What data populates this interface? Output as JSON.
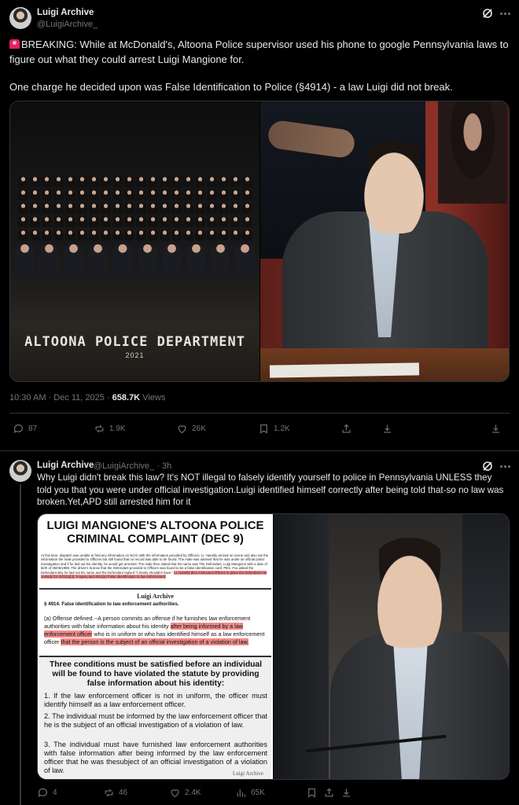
{
  "tweet1": {
    "author_name": "Luigi Archive",
    "author_handle": "@LuigiArchive_",
    "text_line1": "BREAKING: While at McDonald's, Altoona Police supervisor used his phone to google Pennsylvania laws to figure out what they could arrest Luigi Mangione for.",
    "text_line2": "One charge he decided upon was False Identification to Police (§4914) - a law Luigi did not break.",
    "image_left_title": "ALTOONA POLICE DEPARTMENT",
    "image_left_year": "2021",
    "time": "10:30 AM · Dec 11, 2025 · ",
    "views_count": "658.7K",
    "views_label": "Views",
    "replies": "87",
    "reposts": "1.9K",
    "likes": "26K",
    "bookmarks": "1.2K"
  },
  "tweet2": {
    "author_name": "Luigi Archive",
    "author_handle": "@LuigiArchive_ · 3h",
    "text": "Why Luigi didn't break this law? It's NOT illegal to falsely identify yourself to police in Pennsylvania UNLESS they told you that you were under official investigation.Luigi identified himself correctly after being told that-so no law was broken.Yet,APD still arrested him for it",
    "doc_title_line1": "LUIGI MANGIONE'S ALTOONA POLICE",
    "doc_title_line2": "CRIMINAL COMPLAINT (DEC 9)",
    "doc_complaint_text": "At this time, dispatch was unable to find any information on NCIC with the information provided by Officers. Lt. Hanelly arrived on scene and also ran the information the male provided to Officers but still found that no record was able to be found. The male was advised that he was under an official police investigation and if he lied out his identity, he would get arrested. The male then stated that his name was The Defendant, Luigi Mangione with a date of birth of 05/06/1998. The driver's license that the Defendant provided to Officers was found to be a false identification card. Ptlm. Fox asked the Defendant why he lied out his name and the Defendant replied \"I clearly shouldn't have.\"",
    "doc_complaint_highlight": "Lt. Hanelly then instructed Officers to place the Defendant into custody for 4101(a)(3), Forgery and 4914(a) False identification to law enforcement.",
    "doc_watermark": "Luigi Archive",
    "doc_section_head": "§ 4914. False identification to law enforcement authorities.",
    "doc_offense_a": "(a) Offense defined.--A person commits an offense if he furnishes law enforcement authorities with false information about his identity ",
    "doc_offense_hl1": "after being informed by a law enforcement officer",
    "doc_offense_b": " who is in uniform or who has identified himself as a law enforcement officer ",
    "doc_offense_hl2": "that the person is the subject of an official investigation of a violation of law.",
    "doc_conditions_head": "Three conditions must be satisfied before an individual will be found to have violated the statute by providing false information about his identity:",
    "doc_cond_1": "1. If the law enforcement officer is not in uniform, the officer must identify himself as a law enforcement officer.",
    "doc_cond_2": "2. The individual must be informed by the law enforcement officer that he is the subject of an official investigation of a violation of law.",
    "doc_cond_3": "3. The individual must have furnished law enforcement authorities with false information after being informed by the law enforcement officer that he was thesubject of an official investigation of a violation of law.",
    "doc_watermark2": "Luigi Archive",
    "replies": "4",
    "reposts": "46",
    "likes": "2.4K",
    "views": "65K"
  },
  "colors": {
    "background": "#000000",
    "text_primary": "#e7e9ea",
    "text_secondary": "#71767b",
    "divider": "#2f3336",
    "highlight": "#f28b8b"
  },
  "icons": [
    "grok-icon",
    "more-icon",
    "reply-icon",
    "repost-icon",
    "like-icon",
    "bookmark-icon",
    "share-icon",
    "download-icon",
    "views-icon"
  ]
}
